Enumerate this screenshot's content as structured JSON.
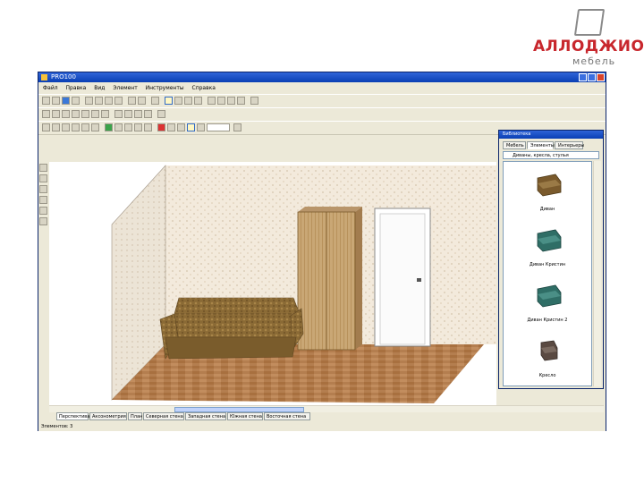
{
  "logo": {
    "brand": "АЛЛОДЖИО",
    "sub": "мебель"
  },
  "window": {
    "title": "PRO100",
    "menu": [
      "Файл",
      "Правка",
      "Вид",
      "Элемент",
      "Инструменты",
      "Справка"
    ]
  },
  "library": {
    "title": "Библиотека",
    "tabs": [
      "Мебель",
      "Элементы",
      "Интерьеры"
    ],
    "active_tab": "Элементы",
    "folder": "Диваны, кресла, стулья",
    "items": [
      {
        "label": "Диван",
        "color": "#7a5a2c"
      },
      {
        "label": "Диван Кристин",
        "color": "#2f6e66"
      },
      {
        "label": "Диван Кристин 2",
        "color": "#2f6e66"
      },
      {
        "label": "Кресло",
        "color": "#5a4a42"
      }
    ]
  },
  "view_tabs": [
    "Перспектива",
    "Аксонометрия",
    "План",
    "Северная стена",
    "Западная стена",
    "Южная стена",
    "Восточная стена"
  ],
  "active_view_tab": "Перспектива",
  "status": {
    "text": "Элементов: 3"
  },
  "colors": {
    "titlebar": "#0a3fb4",
    "brand_red": "#c8272d",
    "wall": "#f1e7d8",
    "floor": "#b17b4e"
  }
}
